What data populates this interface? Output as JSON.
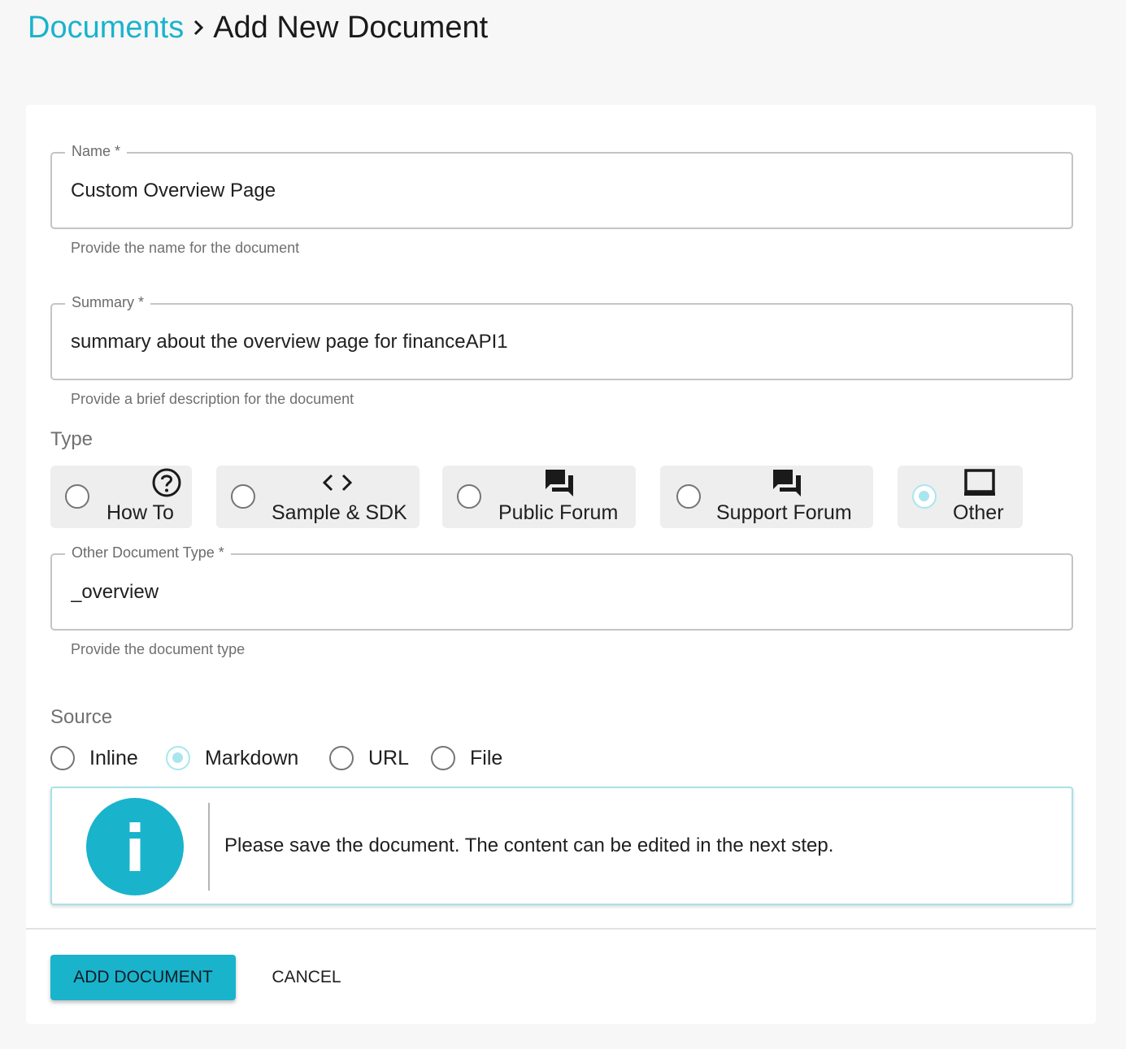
{
  "breadcrumb": {
    "parent": "Documents",
    "current": "Add New Document"
  },
  "form": {
    "name": {
      "label": "Name *",
      "value": "Custom Overview Page",
      "helper": "Provide the name for the document"
    },
    "summary": {
      "label": "Summary *",
      "value": "summary about the overview page for financeAPI1",
      "helper": "Provide a brief description for the document"
    },
    "type": {
      "label": "Type",
      "selected": "Other",
      "options": [
        {
          "label": "How To",
          "icon": "help-circle-icon"
        },
        {
          "label": "Sample & SDK",
          "icon": "code-icon"
        },
        {
          "label": "Public Forum",
          "icon": "forum-icon"
        },
        {
          "label": "Support Forum",
          "icon": "forum-icon"
        },
        {
          "label": "Other",
          "icon": "laptop-icon"
        }
      ]
    },
    "other_type": {
      "label": "Other Document Type *",
      "value": "_overview",
      "helper": "Provide the document type"
    },
    "source": {
      "label": "Source",
      "selected": "Markdown",
      "options": [
        "Inline",
        "Markdown",
        "URL",
        "File"
      ]
    },
    "info": {
      "icon": "info-icon",
      "message": "Please save the document. The content can be edited in the next step."
    }
  },
  "actions": {
    "add_label": "ADD DOCUMENT",
    "cancel_label": "CANCEL"
  },
  "colors": {
    "accent": "#1ab3cc",
    "radio_selected": "#a8e6ef",
    "page_background": "#f7f7f7"
  }
}
